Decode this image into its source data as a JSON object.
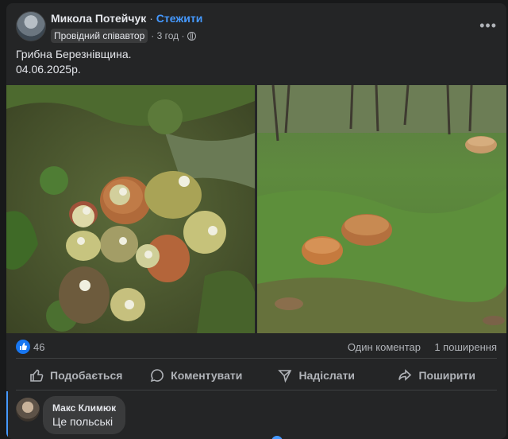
{
  "post": {
    "author": "Микола Потейчук",
    "separator": "·",
    "follow_label": "Стежити",
    "badge": "Провідний співавтор",
    "time": "· 3 год ·",
    "more": "•••",
    "text_line1": "Грибна Березнівщина.",
    "text_line2": "04.06.2025р."
  },
  "photos": [
    {
      "name": "mushrooms-arranged-on-moss"
    },
    {
      "name": "mushrooms-in-grass"
    }
  ],
  "stats": {
    "likes": "46",
    "comments": "Один коментар",
    "shares": "1 поширення"
  },
  "actions": [
    {
      "label": "Подобається",
      "icon": "thumbs-up-icon"
    },
    {
      "label": "Коментувати",
      "icon": "comment-icon"
    },
    {
      "label": "Надіслати",
      "icon": "send-icon"
    },
    {
      "label": "Поширити",
      "icon": "share-icon"
    }
  ],
  "comment": {
    "author": "Макс Климюк",
    "text": "Це польські"
  },
  "colors": {
    "background": "#18191a",
    "card": "#242526",
    "accent": "#4599ff",
    "like": "#1877f2"
  }
}
